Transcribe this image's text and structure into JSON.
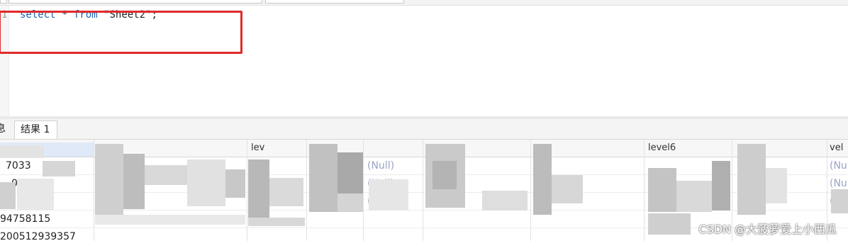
{
  "editor": {
    "line_number": "1",
    "code": {
      "kw1": "select",
      "op": " * ",
      "kw2": "from",
      "space": " ",
      "str": "\"Sheet2\"",
      "end": ";"
    }
  },
  "tabs": {
    "info": "息",
    "result": "结果 1"
  },
  "grid": {
    "headers": [
      "",
      "",
      "lev",
      "",
      "",
      "",
      "",
      "level6",
      "",
      "",
      "vel"
    ],
    "rows": [
      [
        "7033",
        "",
        "",
        "",
        "(Null)",
        "",
        "",
        "",
        "",
        "(Nu"
      ],
      [
        "009",
        "",
        "",
        "",
        "(Null)",
        "",
        "",
        "",
        "",
        "(Nu"
      ],
      [
        "94",
        "",
        "",
        "",
        "(Null)",
        "",
        "",
        "",
        "",
        "(Nu"
      ],
      [
        "94758115",
        "",
        "",
        "",
        "",
        "",
        "",
        "",
        "",
        ""
      ],
      [
        "200512939357",
        "",
        "",
        "",
        "",
        "",
        "",
        "",
        "",
        ""
      ]
    ],
    "colors": {
      "null_text": "#9aa3c4",
      "selection": "#dfe9f7"
    }
  },
  "watermark": "CSDN @大菠萝爱上小西瓜"
}
